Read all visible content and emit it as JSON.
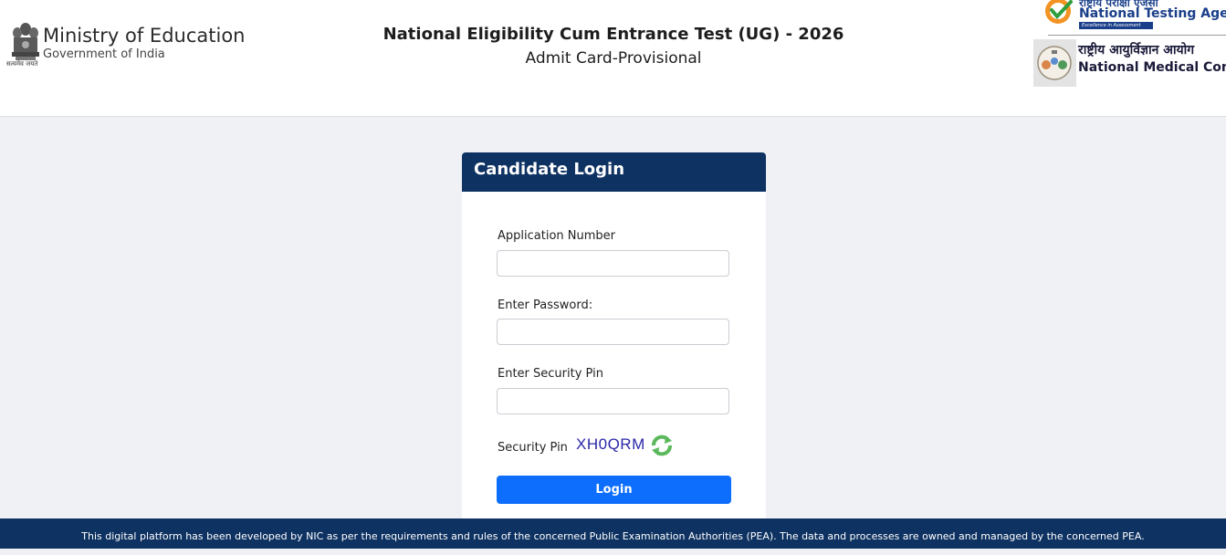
{
  "header": {
    "emblem_motto": "सत्यमेव जयते",
    "ministry_title": "Ministry of Education",
    "ministry_subtitle": "Government of India",
    "exam_title": "National Eligibility Cum Entrance Test (UG) - 2026",
    "exam_subtitle": "Admit Card-Provisional",
    "nta": {
      "hindi": "राष्ट्रीय परीक्षा एजेंसी",
      "name": "National Testing Agenc",
      "tagline": "Excellence in Assessment"
    },
    "nmc": {
      "hindi": "राष्ट्रीय आयुर्विज्ञान आयोग",
      "name": "National Medical Commis"
    }
  },
  "login": {
    "title": "Candidate Login",
    "application_number_label": "Application Number",
    "application_number_value": "",
    "password_label": "Enter Password:",
    "password_value": "",
    "security_pin_input_label": "Enter Security Pin",
    "security_pin_input_value": "",
    "security_pin_label": "Security Pin",
    "security_pin_value": "XH0QRM",
    "login_button": "Login"
  },
  "footer": {
    "text": "This digital platform has been developed by NIC as per the requirements and rules of the concerned Public Examination Authorities (PEA). The data and processes are owned and managed by the concerned PEA."
  },
  "colors": {
    "navy": "#0e3262",
    "primary_button": "#0d6efd",
    "page_background": "#eff1f5",
    "security_pin_text": "#2a27a8",
    "refresh_icon": "#4caf50"
  },
  "icons": {
    "emblem": "national-emblem-icon",
    "nta_logo": "nta-logo-icon",
    "nmc_logo": "nmc-logo-icon",
    "refresh": "refresh-icon"
  }
}
